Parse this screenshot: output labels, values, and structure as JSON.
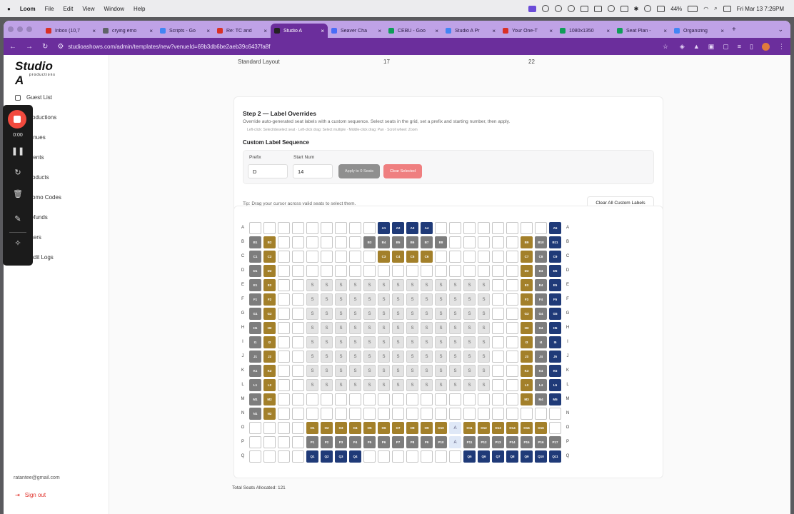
{
  "menubar": {
    "app": "Loom",
    "items": [
      "File",
      "Edit",
      "View",
      "Window",
      "Help"
    ],
    "battery": "44%",
    "datetime": "Fri Mar 13  7:26PM"
  },
  "browser": {
    "tabs": [
      {
        "title": "Inbox (10,7",
        "color": "#d93025",
        "active": false
      },
      {
        "title": "crying emo",
        "color": "#5f6368",
        "active": false
      },
      {
        "title": "Scripts - Go",
        "color": "#4285f4",
        "active": false
      },
      {
        "title": "Re: TC and",
        "color": "#d93025",
        "active": false
      },
      {
        "title": "Studio A",
        "color": "#222222",
        "active": true
      },
      {
        "title": "Seaver Cha",
        "color": "#4a6cf7",
        "active": false
      },
      {
        "title": "CEBU - Goo",
        "color": "#0f9d58",
        "active": false
      },
      {
        "title": "Studio A Pr",
        "color": "#4285f4",
        "active": false
      },
      {
        "title": "Your One-T",
        "color": "#d93025",
        "active": false
      },
      {
        "title": "1080x1350",
        "color": "#0f9d58",
        "active": false
      },
      {
        "title": "Seat Plan -",
        "color": "#0f9d58",
        "active": false
      },
      {
        "title": "Organizing",
        "color": "#4285f4",
        "active": false
      }
    ],
    "url": "studioashows.com/admin/templates/new?venueId=69b3db6be2aeb39c6437fa8f"
  },
  "sidebar": {
    "logo": "Studio A",
    "logo_sub": "productions",
    "nav": [
      {
        "label": "Guest List",
        "icon": "users-icon"
      },
      {
        "label": "Productions",
        "icon": "film-icon"
      },
      {
        "label": "Venues",
        "icon": "map-pin-icon"
      },
      {
        "label": "Events",
        "icon": "calendar-icon"
      },
      {
        "label": "Products",
        "icon": "box-icon"
      },
      {
        "label": "Promo Codes",
        "icon": "tag-icon"
      },
      {
        "label": "Refunds",
        "icon": "refund-icon"
      },
      {
        "label": "Users",
        "icon": "user-icon"
      },
      {
        "label": "Audit Logs",
        "icon": "log-icon"
      }
    ],
    "email": "ratantee@gmail.com",
    "signout": "Sign out"
  },
  "loom": {
    "time": "0:00"
  },
  "main": {
    "top_row": {
      "name": "Standard Layout",
      "col1": "17",
      "col2": "22"
    },
    "step2": {
      "title": "Step 2 — Label Overrides",
      "desc": "Override auto-generated seat labels with a custom sequence. Select seats in the grid, set a prefix and starting number, then apply.",
      "hint": "Left-click: Select/deselect seat · Left-click drag: Select multiple · Middle-click drag: Pan · Scroll wheel: Zoom",
      "custom_title": "Custom Label Sequence",
      "prefix_label": "Prefix",
      "prefix_value": "D",
      "start_label": "Start Num",
      "start_value": "14",
      "apply_btn": "Apply to 0 Seats",
      "clear_btn": "Clear Selected",
      "tip": "Tip: Drag your cursor across valid seats to select them.",
      "clear_all_btn": "Clear All Custom Labels"
    },
    "total": "Total Seats Allocated: 121"
  },
  "seat_colors": {
    "blue": "#1f3a78",
    "gold": "#a3802a",
    "grey": "#7d7d7d",
    "stage": "#e3e3e3"
  },
  "seats": {
    "rows": [
      "A",
      "B",
      "C",
      "D",
      "E",
      "F",
      "G",
      "H",
      "I",
      "J",
      "K",
      "L",
      "M",
      "N",
      "O",
      "P",
      "Q"
    ],
    "legend": "types: e=empty, b=blue, g=gold, x=grey, s=stage(S), a=aisle(A)",
    "grid": [
      [
        "e",
        "e",
        "e",
        "e",
        "e",
        "e",
        "e",
        "e",
        "e",
        "b",
        "b",
        "b",
        "b",
        "e",
        "e",
        "e",
        "e",
        "e",
        "e",
        "e",
        "e",
        "b"
      ],
      [
        "x",
        "g",
        "e",
        "e",
        "e",
        "e",
        "e",
        "e",
        "x",
        "x",
        "x",
        "x",
        "x",
        "x",
        "e",
        "e",
        "e",
        "e",
        "e",
        "g",
        "x",
        "b"
      ],
      [
        "x",
        "g",
        "e",
        "e",
        "e",
        "e",
        "e",
        "e",
        "e",
        "g",
        "g",
        "g",
        "g",
        "e",
        "e",
        "e",
        "e",
        "e",
        "e",
        "g",
        "x",
        "b"
      ],
      [
        "x",
        "g",
        "e",
        "e",
        "e",
        "e",
        "e",
        "e",
        "e",
        "e",
        "e",
        "e",
        "e",
        "e",
        "e",
        "e",
        "e",
        "e",
        "e",
        "g",
        "x",
        "b"
      ],
      [
        "x",
        "g",
        "e",
        "e",
        "s",
        "s",
        "s",
        "s",
        "s",
        "s",
        "s",
        "s",
        "s",
        "s",
        "s",
        "s",
        "s",
        "e",
        "e",
        "g",
        "x",
        "b"
      ],
      [
        "x",
        "g",
        "e",
        "e",
        "s",
        "s",
        "s",
        "s",
        "s",
        "s",
        "s",
        "s",
        "s",
        "s",
        "s",
        "s",
        "s",
        "e",
        "e",
        "g",
        "x",
        "b"
      ],
      [
        "x",
        "g",
        "e",
        "e",
        "s",
        "s",
        "s",
        "s",
        "s",
        "s",
        "s",
        "s",
        "s",
        "s",
        "s",
        "s",
        "s",
        "e",
        "e",
        "g",
        "x",
        "b"
      ],
      [
        "x",
        "g",
        "e",
        "e",
        "s",
        "s",
        "s",
        "s",
        "s",
        "s",
        "s",
        "s",
        "s",
        "s",
        "s",
        "s",
        "s",
        "e",
        "e",
        "g",
        "x",
        "b"
      ],
      [
        "x",
        "g",
        "e",
        "e",
        "s",
        "s",
        "s",
        "s",
        "s",
        "s",
        "s",
        "s",
        "s",
        "s",
        "s",
        "s",
        "s",
        "e",
        "e",
        "g",
        "x",
        "b"
      ],
      [
        "x",
        "g",
        "e",
        "e",
        "s",
        "s",
        "s",
        "s",
        "s",
        "s",
        "s",
        "s",
        "s",
        "s",
        "s",
        "s",
        "s",
        "e",
        "e",
        "g",
        "x",
        "b"
      ],
      [
        "x",
        "g",
        "e",
        "e",
        "s",
        "s",
        "s",
        "s",
        "s",
        "s",
        "s",
        "s",
        "s",
        "s",
        "s",
        "s",
        "s",
        "e",
        "e",
        "g",
        "x",
        "b"
      ],
      [
        "x",
        "g",
        "e",
        "e",
        "s",
        "s",
        "s",
        "s",
        "s",
        "s",
        "s",
        "s",
        "s",
        "s",
        "s",
        "s",
        "s",
        "e",
        "e",
        "g",
        "x",
        "b"
      ],
      [
        "x",
        "g",
        "e",
        "e",
        "e",
        "e",
        "e",
        "e",
        "e",
        "e",
        "e",
        "e",
        "e",
        "e",
        "e",
        "e",
        "e",
        "e",
        "e",
        "g",
        "x",
        "b"
      ],
      [
        "x",
        "g",
        "e",
        "e",
        "e",
        "e",
        "e",
        "e",
        "e",
        "e",
        "e",
        "e",
        "e",
        "e",
        "e",
        "e",
        "e",
        "e",
        "e",
        "e",
        "e",
        "e"
      ],
      [
        "e",
        "e",
        "e",
        "e",
        "g",
        "g",
        "g",
        "g",
        "g",
        "g",
        "g",
        "g",
        "g",
        "g",
        "a",
        "g",
        "g",
        "g",
        "g",
        "g",
        "g",
        "e"
      ],
      [
        "e",
        "e",
        "e",
        "e",
        "x",
        "x",
        "x",
        "x",
        "x",
        "x",
        "x",
        "x",
        "x",
        "x",
        "a",
        "x",
        "x",
        "x",
        "x",
        "x",
        "x",
        "x"
      ],
      [
        "e",
        "e",
        "e",
        "e",
        "b",
        "b",
        "b",
        "b",
        "e",
        "e",
        "e",
        "e",
        "e",
        "e",
        "e",
        "b",
        "b",
        "b",
        "b",
        "b",
        "b",
        "b"
      ]
    ],
    "labels": [
      [
        "",
        "",
        "",
        "",
        "",
        "",
        "",
        "",
        "",
        "A1",
        "A2",
        "A3",
        "A4",
        "",
        "",
        "",
        "",
        "",
        "",
        "",
        "",
        "A5"
      ],
      [
        "B1",
        "B2",
        "",
        "",
        "",
        "",
        "",
        "",
        "B3",
        "B4",
        "B5",
        "B6",
        "B7",
        "B8",
        "",
        "",
        "",
        "",
        "",
        "B9",
        "B10",
        "B11"
      ],
      [
        "C1",
        "C2",
        "",
        "",
        "",
        "",
        "",
        "",
        "",
        "C3",
        "C4",
        "C5",
        "C6",
        "",
        "",
        "",
        "",
        "",
        "",
        "C7",
        "C8",
        "C9"
      ],
      [
        "D1",
        "D2",
        "",
        "",
        "",
        "",
        "",
        "",
        "",
        "",
        "",
        "",
        "",
        "",
        "",
        "",
        "",
        "",
        "",
        "D3",
        "D4",
        "D5"
      ],
      [
        "E1",
        "E2",
        "",
        "",
        "S",
        "S",
        "S",
        "S",
        "S",
        "S",
        "S",
        "S",
        "S",
        "S",
        "S",
        "S",
        "S",
        "",
        "",
        "E3",
        "E4",
        "E5"
      ],
      [
        "F1",
        "F2",
        "",
        "",
        "S",
        "S",
        "S",
        "S",
        "S",
        "S",
        "S",
        "S",
        "S",
        "S",
        "S",
        "S",
        "S",
        "",
        "",
        "F3",
        "F4",
        "F5"
      ],
      [
        "G1",
        "G2",
        "",
        "",
        "S",
        "S",
        "S",
        "S",
        "S",
        "S",
        "S",
        "S",
        "S",
        "S",
        "S",
        "S",
        "S",
        "",
        "",
        "G3",
        "G4",
        "G5"
      ],
      [
        "H1",
        "H2",
        "",
        "",
        "S",
        "S",
        "S",
        "S",
        "S",
        "S",
        "S",
        "S",
        "S",
        "S",
        "S",
        "S",
        "S",
        "",
        "",
        "H3",
        "H4",
        "H5"
      ],
      [
        "I1",
        "I2",
        "",
        "",
        "S",
        "S",
        "S",
        "S",
        "S",
        "S",
        "S",
        "S",
        "S",
        "S",
        "S",
        "S",
        "S",
        "",
        "",
        "I3",
        "I4",
        "I5"
      ],
      [
        "J1",
        "J2",
        "",
        "",
        "S",
        "S",
        "S",
        "S",
        "S",
        "S",
        "S",
        "S",
        "S",
        "S",
        "S",
        "S",
        "S",
        "",
        "",
        "J3",
        "J4",
        "J5"
      ],
      [
        "K1",
        "K2",
        "",
        "",
        "S",
        "S",
        "S",
        "S",
        "S",
        "S",
        "S",
        "S",
        "S",
        "S",
        "S",
        "S",
        "S",
        "",
        "",
        "K3",
        "K4",
        "K5"
      ],
      [
        "L1",
        "L2",
        "",
        "",
        "S",
        "S",
        "S",
        "S",
        "S",
        "S",
        "S",
        "S",
        "S",
        "S",
        "S",
        "S",
        "S",
        "",
        "",
        "L3",
        "L4",
        "L5"
      ],
      [
        "M1",
        "M2",
        "",
        "",
        "",
        "",
        "",
        "",
        "",
        "",
        "",
        "",
        "",
        "",
        "",
        "",
        "",
        "",
        "",
        "M3",
        "M4",
        "M5"
      ],
      [
        "N1",
        "N2",
        "",
        "",
        "",
        "",
        "",
        "",
        "",
        "",
        "",
        "",
        "",
        "",
        "",
        "",
        "",
        "",
        "",
        "",
        "",
        ""
      ],
      [
        "",
        "",
        "",
        "",
        "O1",
        "O2",
        "O3",
        "O4",
        "O5",
        "O6",
        "O7",
        "O8",
        "O9",
        "O10",
        "A",
        "O11",
        "O12",
        "O13",
        "O14",
        "O15",
        "O16",
        ""
      ],
      [
        "",
        "",
        "",
        "",
        "P1",
        "P2",
        "P3",
        "P4",
        "P5",
        "P6",
        "P7",
        "P8",
        "P9",
        "P10",
        "A",
        "P11",
        "P12",
        "P13",
        "P14",
        "P15",
        "P16",
        "P17"
      ],
      [
        "",
        "",
        "",
        "",
        "Q1",
        "Q2",
        "Q3",
        "Q4",
        "",
        "",
        "",
        "",
        "",
        "",
        "",
        "Q5",
        "Q6",
        "Q7",
        "Q8",
        "Q9",
        "Q10",
        "Q11"
      ]
    ]
  }
}
